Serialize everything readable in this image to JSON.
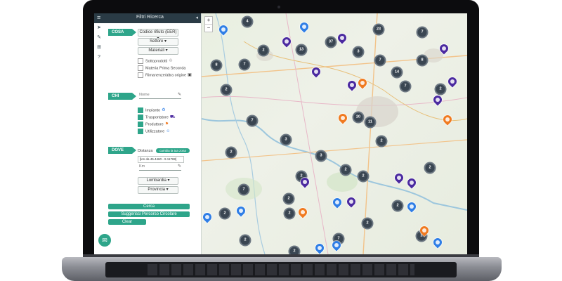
{
  "sidebar": {
    "title": "Filtri Ricerca",
    "menu_icon": "≡",
    "collapse_icon": "◂",
    "icons": [
      "navigate-icon",
      "edit-icon",
      "cart-icon",
      "help-icon"
    ],
    "sections": {
      "cosa": "COSA",
      "chi": "CHI",
      "dove": "DOVE"
    },
    "cosa_dropdowns": [
      "Codice rifiuto (EER) ▾",
      "Settore ▾",
      "Materiali ▾"
    ],
    "cosa_checks": [
      {
        "label": "Sottoprodotti",
        "checked": false
      },
      {
        "label": "Materia Prima Seconda",
        "checked": false
      },
      {
        "label": "Rimanenze/altra origine",
        "checked": false
      }
    ],
    "chi_name_placeholder": "Nome",
    "chi_checks": [
      {
        "label": "Impianto",
        "checked": true
      },
      {
        "label": "Trasportatore",
        "checked": true
      },
      {
        "label": "Produttore",
        "checked": true
      },
      {
        "label": "Utilizzatore",
        "checked": true
      }
    ],
    "dove_distance_label": "Distanza",
    "dove_change_zone": "cambia la tua zona",
    "dove_coords": "[km da 45.4460 - 9.11788]",
    "dove_km_placeholder": "Km",
    "dove_dropdowns": [
      "Lombardia ▾",
      "Provincia ▾"
    ],
    "buttons": {
      "search": "Cerca",
      "route": "Suggerisci Percorso Circolare",
      "clear": "Clear"
    },
    "mail_icon": "✉"
  },
  "map": {
    "zoom_in": "+",
    "zoom_out": "−",
    "clusters": [
      "4",
      "8",
      "2",
      "13",
      "3",
      "7",
      "37",
      "23",
      "7",
      "8",
      "7",
      "14",
      "7",
      "2",
      "20",
      "11",
      "2",
      "7",
      "3",
      "2",
      "3",
      "2",
      "2",
      "2",
      "2",
      "2",
      "7",
      "2",
      "2",
      "2",
      "2",
      "2",
      "7",
      "2",
      "2",
      "2"
    ]
  },
  "colors": {
    "accent": "#2ea58a",
    "cluster": "#3a4652",
    "impianto": "#2f7ee6",
    "trasportatore": "#4b2aa0",
    "produttore": "#f07a20"
  }
}
